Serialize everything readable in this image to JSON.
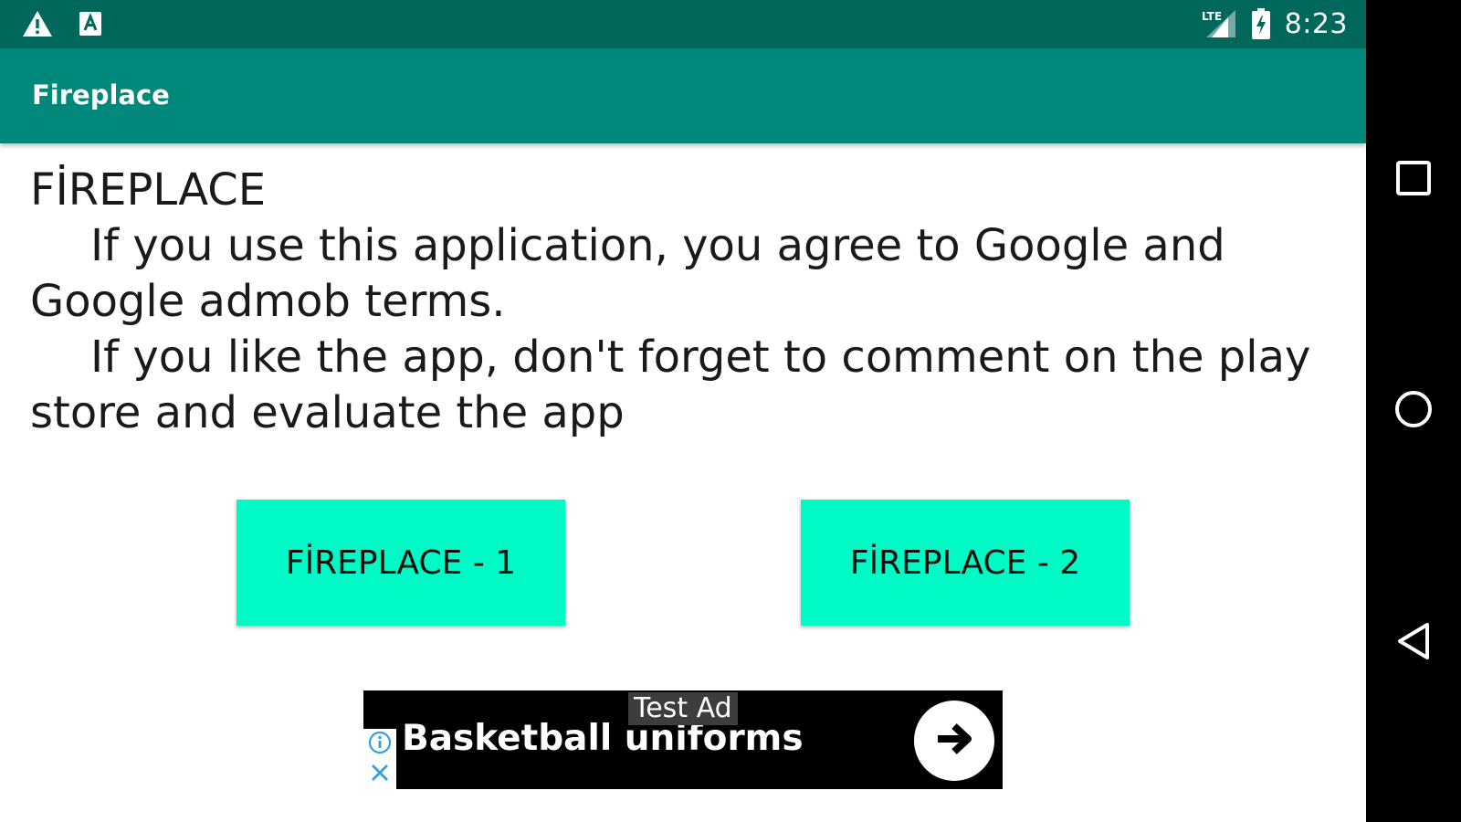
{
  "status_bar": {
    "time": "8:23",
    "icons": [
      "warning-icon",
      "notification-a-icon",
      "signal-lte-icon",
      "battery-charging-icon"
    ],
    "color": "#00675b"
  },
  "app_bar": {
    "title": "Fireplace",
    "color": "#00897b"
  },
  "content": {
    "heading": "FİREPLACE",
    "paragraphs": [
      "If you use this application, you agree to Google and Google admob terms.",
      "If you like the app, don't forget to comment on the play store and evaluate the app"
    ]
  },
  "buttons": [
    {
      "label": "FİREPLACE - 1"
    },
    {
      "label": "FİREPLACE - 2"
    }
  ],
  "button_color": "#00fac5",
  "ad": {
    "label": "Test Ad",
    "headline": "Basketball uniforms",
    "icons": [
      "ad-info-icon",
      "ad-close-icon",
      "arrow-right-icon"
    ]
  },
  "nav_bar": {
    "icons": [
      "recents-icon",
      "home-icon",
      "back-icon"
    ]
  }
}
